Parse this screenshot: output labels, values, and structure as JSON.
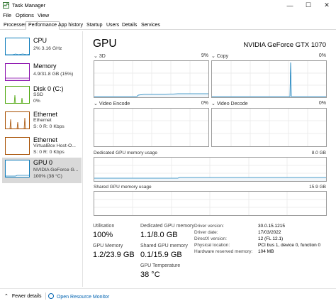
{
  "window": {
    "title": "Task Manager",
    "controls": {
      "minimize": "—",
      "maximize": "☐",
      "close": "✕"
    }
  },
  "menu": [
    "File",
    "Options",
    "View"
  ],
  "tabs": [
    "Processes",
    "Performance",
    "App history",
    "Startup",
    "Users",
    "Details",
    "Services"
  ],
  "active_tab": "Performance",
  "sidebar": [
    {
      "title": "CPU",
      "lines": [
        "2% 3.16 GHz"
      ],
      "color": "#117dbb"
    },
    {
      "title": "Memory",
      "lines": [
        "4.9/31.8 GB (15%)"
      ],
      "color": "#8b12ae"
    },
    {
      "title": "Disk 0 (C:)",
      "lines": [
        "SSD",
        "0%"
      ],
      "color": "#4da60c"
    },
    {
      "title": "Ethernet",
      "lines": [
        "Ethernet",
        "S: 0 R: 0 Kbps"
      ],
      "color": "#a74f01"
    },
    {
      "title": "Ethernet",
      "lines": [
        "VirtualBox Host-O...",
        "S: 0 R: 0 Kbps"
      ],
      "color": "#a74f01"
    },
    {
      "title": "GPU 0",
      "lines": [
        "NVIDIA GeForce G...",
        "100% (38 °C)"
      ],
      "color": "#117dbb"
    }
  ],
  "main": {
    "title": "GPU",
    "model": "NVIDIA GeForce GTX 1070",
    "engines": [
      {
        "name": "3D",
        "pct": "9%"
      },
      {
        "name": "Copy",
        "pct": "0%"
      },
      {
        "name": "Video Encode",
        "pct": "0%"
      },
      {
        "name": "Video Decode",
        "pct": "0%"
      }
    ],
    "dedicated": {
      "label": "Dedicated GPU memory usage",
      "max": "8.0 GB"
    },
    "shared": {
      "label": "Shared GPU memory usage",
      "max": "15.9 GB"
    },
    "stats": {
      "utilisation_label": "Utilisation",
      "utilisation": "100%",
      "dedicated_label": "Dedicated GPU memory",
      "dedicated": "1.1/8.0 GB",
      "gpu_memory_label": "GPU Memory",
      "gpu_memory": "1.2/23.9 GB",
      "shared_label": "Shared GPU memory",
      "shared": "0.1/15.9 GB",
      "temp_label": "GPU Temperature",
      "temp": "38 °C"
    },
    "info": [
      {
        "label": "Driver version:",
        "value": "30.0.15.1215"
      },
      {
        "label": "Driver date:",
        "value": "17/03/2022"
      },
      {
        "label": "DirectX version:",
        "value": "12 (FL 12.1)"
      },
      {
        "label": "Physical location:",
        "value": "PCI bus 1, device 0, function 0"
      },
      {
        "label": "Hardware reserved memory:",
        "value": "104 MB"
      }
    ]
  },
  "footer": {
    "fewer_details": "Fewer details",
    "open_monitor": "Open Resource Monitor"
  },
  "colors": {
    "gpu_line": "#117dbb",
    "gpu_fill": "#f1f6fa",
    "link": "#0063b1"
  }
}
